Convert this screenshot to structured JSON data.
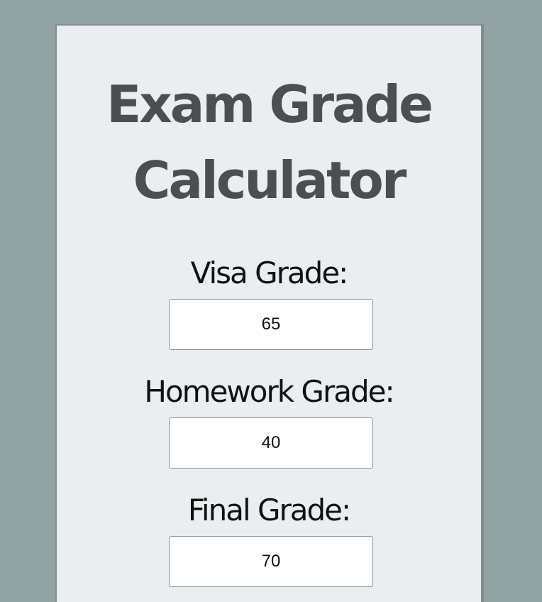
{
  "title": {
    "line1": "Exam Grade",
    "line2": "Calculator"
  },
  "fields": {
    "visa": {
      "label": "Visa Grade:",
      "value": "65"
    },
    "homework": {
      "label": "Homework Grade:",
      "value": "40"
    },
    "final": {
      "label": "Final Grade:",
      "value": "70"
    }
  },
  "colors": {
    "page_background": "#92a3a4",
    "card_background": "#eaeef0",
    "title": "#4a5052",
    "label": "#111111",
    "input_border": "#8f9395"
  }
}
